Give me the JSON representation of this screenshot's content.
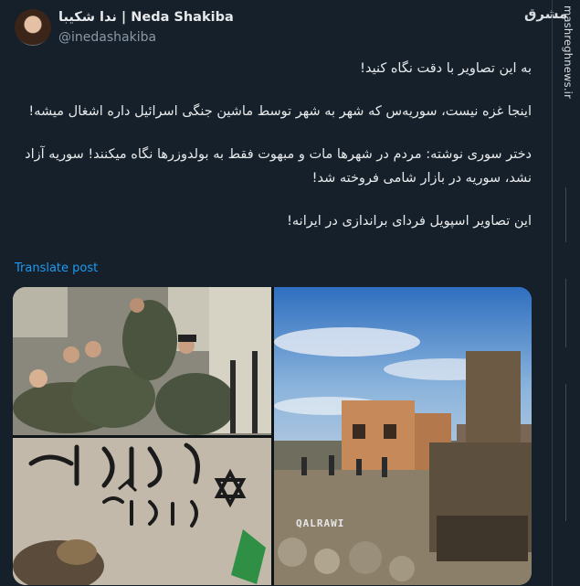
{
  "author": {
    "name_fa": "ندا شکیبا",
    "separator": " | ",
    "name_en": "Neda Shakiba",
    "handle": "@inedashakiba"
  },
  "site": {
    "watermark": "مشرق",
    "side_label": "mashreghnews.ir"
  },
  "post": {
    "paragraphs": [
      "به این تصاویر با دقت نگاه کنید!",
      "اینجا غزه نیست، سوریه‌س که شهر به شهر توسط ماشین جنگی اسرائیل داره اشغال میشه!",
      "دختر سوری نوشته: مردم در شهرها مات و مبهوت فقط به بولدوزرها نگاه میکنند! سوریه آزاد نشد، سوریه در بازار شامی فروخته شد!",
      "این تصاویر اسپویل فردای براندازی در ایرانه!"
    ]
  },
  "translate_label": "Translate post",
  "media": {
    "images": [
      {
        "name": "soldiers-photo"
      },
      {
        "name": "hebrew-graffiti-photo"
      },
      {
        "name": "bulldozer-village-photo"
      }
    ],
    "video_watermark": "QALRAWI"
  }
}
